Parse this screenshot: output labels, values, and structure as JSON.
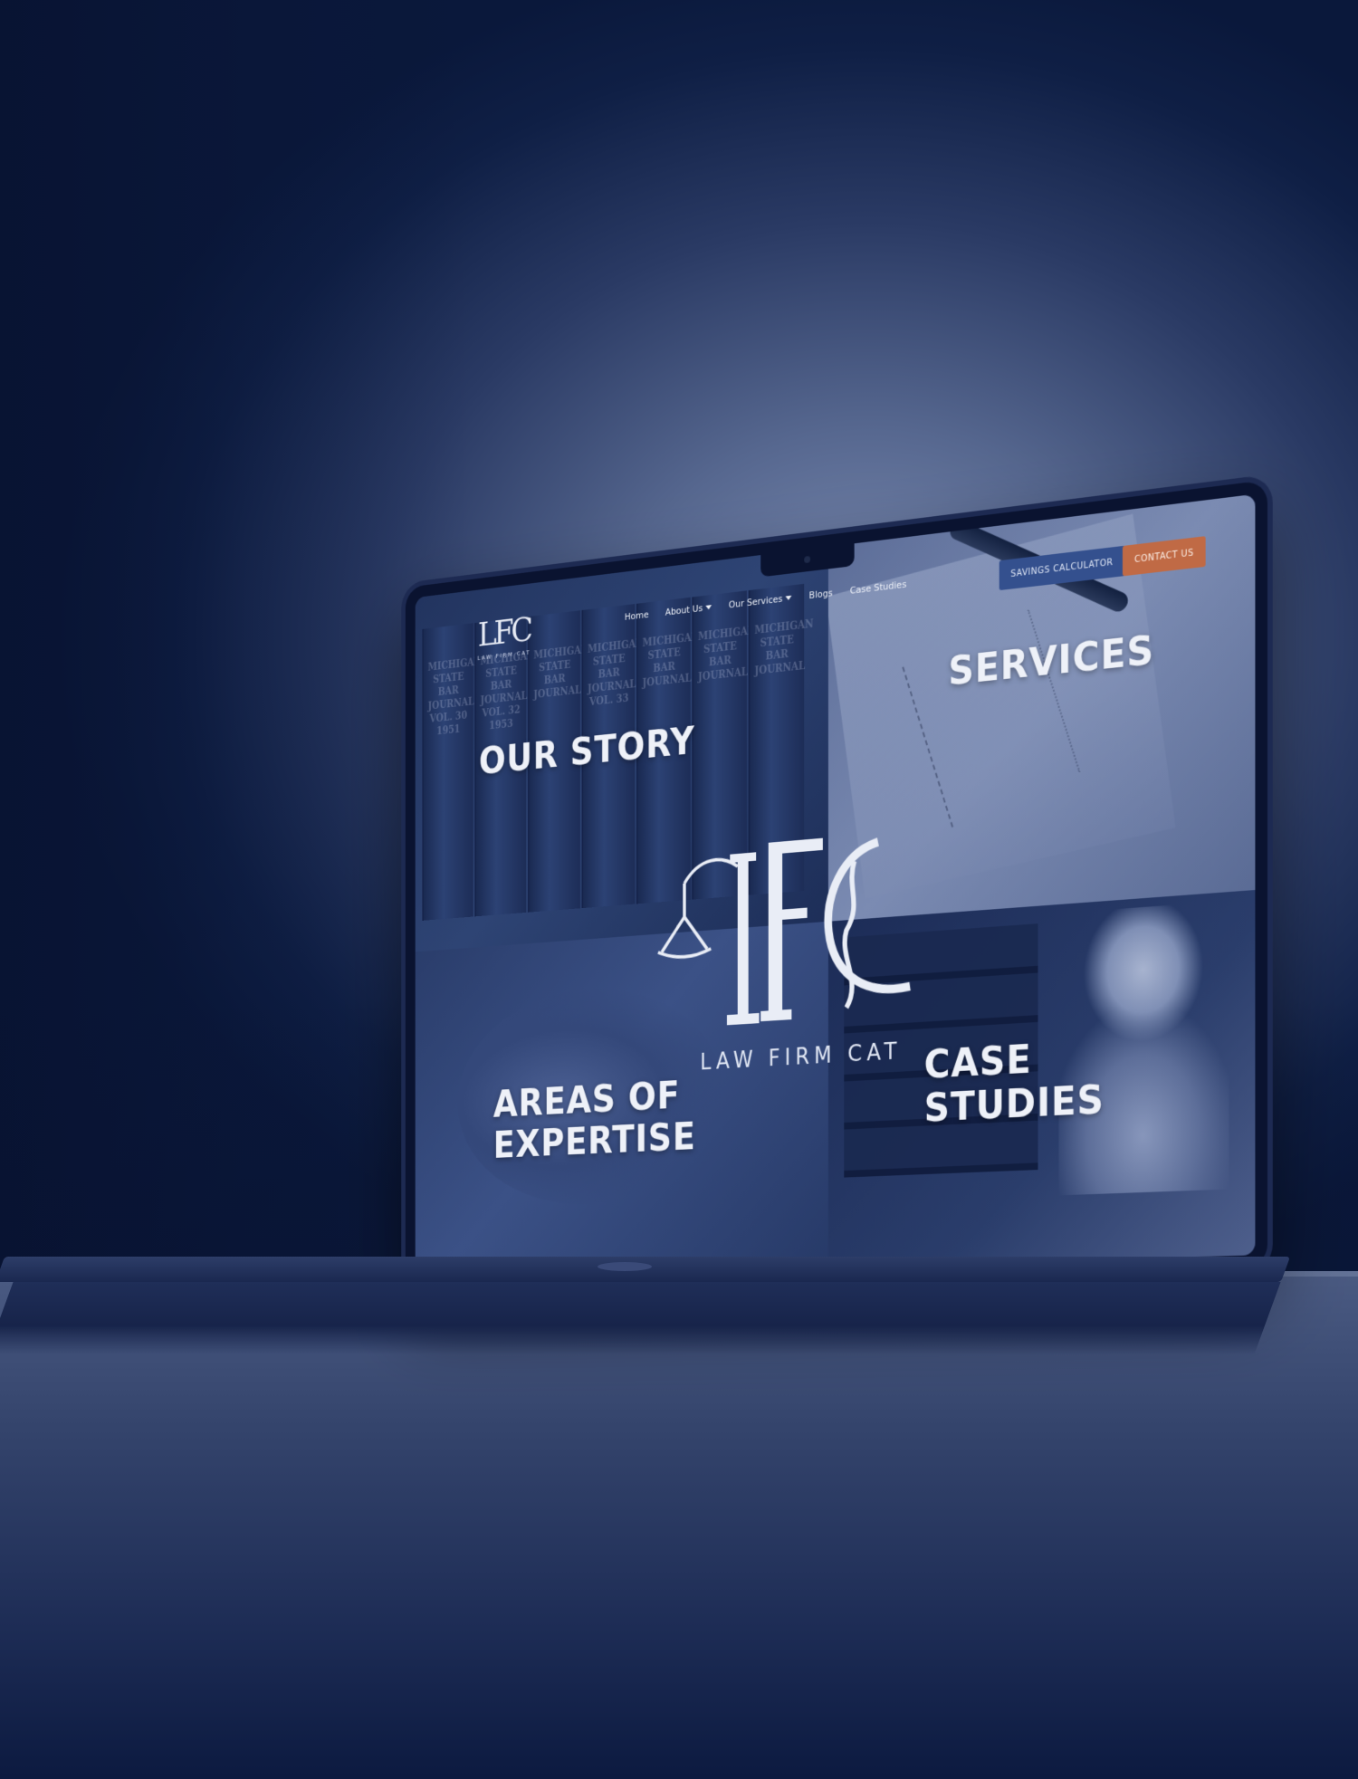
{
  "nav": {
    "logo_caption": "LAW FIRM CAT",
    "links": [
      {
        "label": "Home",
        "has_dropdown": false
      },
      {
        "label": "About Us",
        "has_dropdown": true
      },
      {
        "label": "Our Services",
        "has_dropdown": true
      },
      {
        "label": "Blogs",
        "has_dropdown": false
      },
      {
        "label": "Case Studies",
        "has_dropdown": false
      }
    ],
    "calc_button": "SAVINGS CALCULATOR",
    "contact_button": "CONTACT US"
  },
  "quadrants": {
    "story": "OUR STORY",
    "services": "SERVICES",
    "expertise_line1": "AREAS OF",
    "expertise_line2": "EXPERTISE",
    "cases_line1": "CASE",
    "cases_line2": "STUDIES"
  },
  "books": [
    [
      "MICHIGAN",
      "STATE BAR",
      "JOURNAL",
      "VOL. 30",
      "1951"
    ],
    [
      "MICHIGAN",
      "STATE BAR",
      "JOURNAL",
      "VOL. 32",
      "1953"
    ],
    [
      "MICHIGAN",
      "STATE BAR",
      "JOURNAL"
    ],
    [
      "MICHIGAN",
      "STATE BAR",
      "JOURNAL",
      "VOL. 33"
    ],
    [
      "MICHIGAN",
      "STATE BAR",
      "JOURNAL"
    ],
    [
      "MICHIGAN",
      "STATE BAR",
      "JOURNAL"
    ],
    [
      "MICHIGAN",
      "STATE BAR",
      "JOURNAL"
    ]
  ],
  "center_logo": {
    "caption": "LAW FIRM CAT"
  },
  "colors": {
    "navy": "#1b2d5c",
    "accent_orange": "#c06a45",
    "accent_blue": "#34508e",
    "text_light": "#eef1f8"
  }
}
